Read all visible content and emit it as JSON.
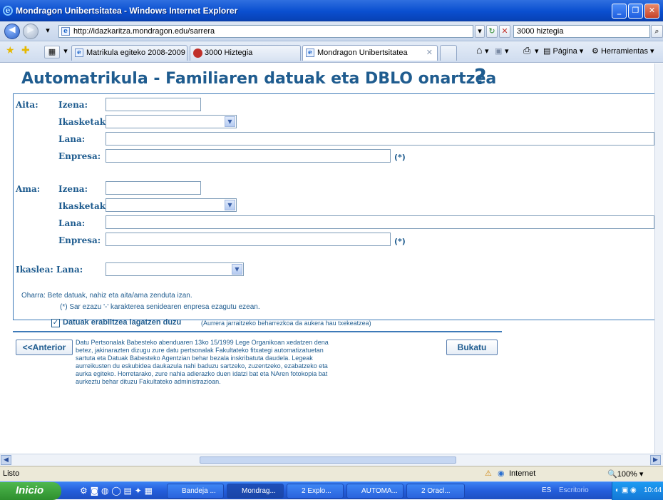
{
  "window": {
    "title": "Mondragon Unibertsitatea - Windows Internet Explorer"
  },
  "address": {
    "url": "http://idazkaritza.mondragon.edu/sarrera",
    "search_value": "3000 hiztegia"
  },
  "tabs": [
    {
      "label": "Matrikula egiteko 2008-2009 ..."
    },
    {
      "label": "3000 Hiztegia"
    },
    {
      "label": "Mondragon Unibertsitatea"
    }
  ],
  "commands": {
    "page": "Página",
    "tools": "Herramientas"
  },
  "page": {
    "title": "Automatrikula - Familiaren datuak eta DBLO onartzea",
    "help": "?",
    "aita": {
      "section": "Aita:",
      "izena": "Izena:",
      "ikasketak": "Ikasketak:",
      "lana": "Lana:",
      "enpresa": "Enpresa:",
      "star": "(*)"
    },
    "ama": {
      "section": "Ama:",
      "izena": "Izena:",
      "ikasketak": "Ikasketak:",
      "lana": "Lana:",
      "enpresa": "Enpresa:",
      "star": "(*)"
    },
    "ikaslea": {
      "label": "Ikaslea: Lana:"
    },
    "note1": "Oharra: Bete datuak, nahiz eta aita/ama zenduta izan.",
    "note2": "(*) Sar ezazu '-' karakterea senidearen enpresa ezagutu ezean.",
    "consent": {
      "label": "Datuak erabiltzea lagatzen duzu",
      "hint": "(Aurrera jarraitzeko beharrezkoa da aukera hau txekeatzea)",
      "checked": true
    },
    "anterior": "<<Anterior",
    "bukatu": "Bukatu",
    "legal": "Datu Pertsonalak Babesteko abenduaren 13ko 15/1999 Lege Organikoan xedatzen dena betez, jakinarazten dizugu zure datu pertsonalak Fakultateko fitxategi automatizatuetan sartuta eta Datuak Babesteko Agentzian behar bezala inskribatuta daudela. Legeak aurreikusten du eskubidea daukazula nahi baduzu sartzeko, zuzentzeko, ezabatzeko eta aurka egiteko. Horretarako, zure nahia adierazko duen idatzi bat eta NAren fotokopia bat aurkeztu behar dituzu Fakultateko administrazioan."
  },
  "status": {
    "text": "Listo",
    "zone": "Internet",
    "zoom": "100%"
  },
  "taskbar": {
    "start": "Inicio",
    "tasks": [
      "Bandeja ...",
      "Mondrag...",
      "2 Explo...",
      "AUTOMA...",
      "2 Oracl..."
    ],
    "lang": "ES",
    "desktop": "Escritorio",
    "clock": "10:44"
  }
}
